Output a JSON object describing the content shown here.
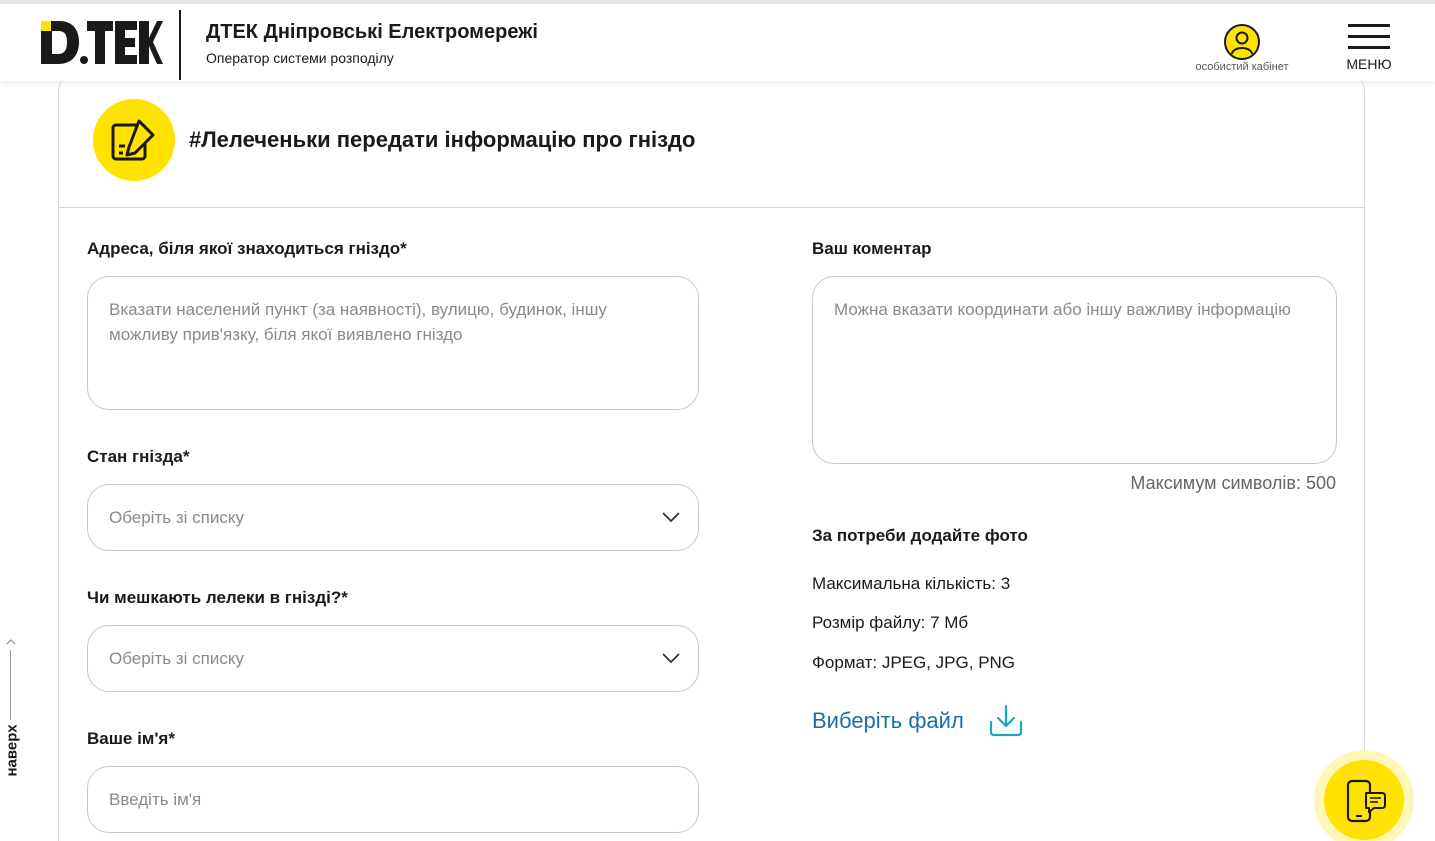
{
  "header": {
    "company_name": "ДТЕК Дніпровські Електромережі",
    "company_sub": "Оператор системи розподілу",
    "cabinet_label": "особистий кабінет",
    "menu_label": "МЕНЮ",
    "logo_text": "D.TEK"
  },
  "form": {
    "title": "#Лелеченьки передати інформацію про гніздо",
    "address": {
      "label": "Адреса, біля якої знаходиться гніздо*",
      "placeholder": "Вказати населений пункт (за наявності), вулицю, будинок, іншу можливу прив'язку, біля якої виявлено гніздо"
    },
    "nest_state": {
      "label": "Стан гнізда*",
      "placeholder": "Оберіть зі списку"
    },
    "storks_live": {
      "label": "Чи мешкають лелеки в гнізді?*",
      "placeholder": "Оберіть зі списку"
    },
    "name": {
      "label": "Ваше ім'я*",
      "placeholder": "Введіть ім'я"
    },
    "comment": {
      "label": "Ваш коментар",
      "placeholder": "Можна вказати координати або іншу важливу інформацію",
      "counter": "Максимум символів: 500"
    },
    "photo": {
      "label": "За потреби додайте фото",
      "max_count": "Максимальна кількість: 3",
      "file_size": "Розмір файлу: 7 Мб",
      "format": "Формат: JPEG, JPG, PNG",
      "choose_file": "Виберіть файл"
    }
  },
  "to_top_label": "наверх",
  "colors": {
    "brand_yellow": "#ffe200",
    "link_blue": "#1a6fa8",
    "border": "#c8c8c8"
  }
}
